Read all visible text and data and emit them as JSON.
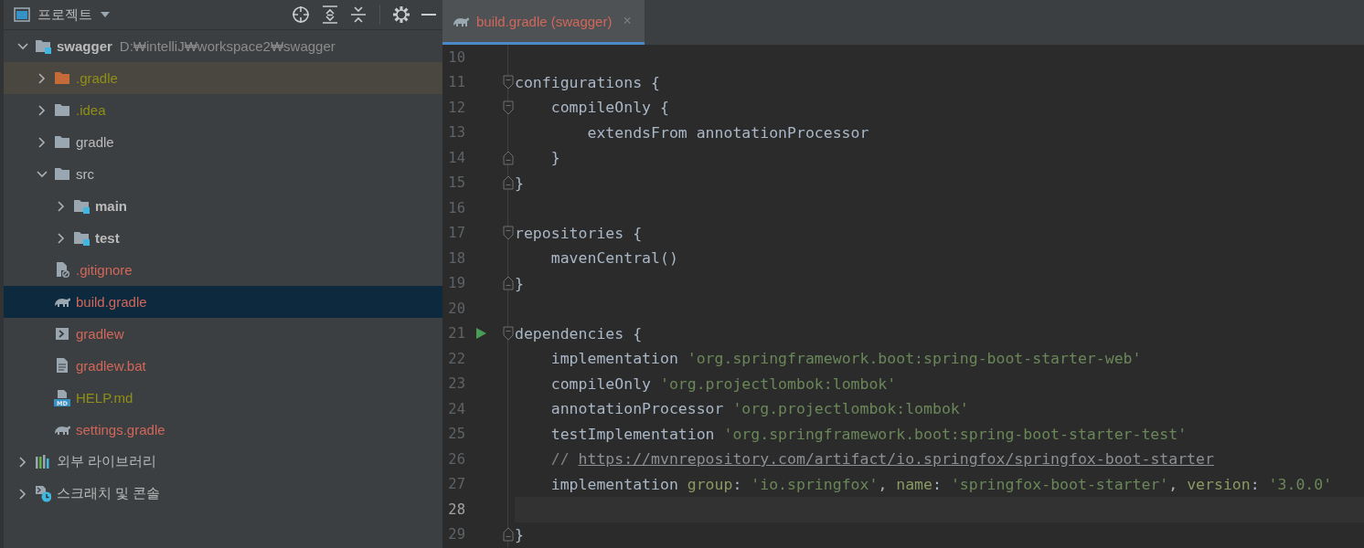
{
  "project_panel": {
    "title": "프로젝트",
    "tree": [
      {
        "label": "swagger",
        "kind": "module",
        "path": "D:₩intelliJ₩workspace2₩swagger",
        "selected": false,
        "expanded": true,
        "children": [
          {
            "label": ".gradle",
            "kind": "excluded-folder",
            "color": "#8f8f16",
            "selected": false,
            "expanded": false
          },
          {
            "label": ".idea",
            "kind": "folder",
            "color": "#8f8f16",
            "selected": false,
            "expanded": false
          },
          {
            "label": "gradle",
            "kind": "folder",
            "selected": false,
            "expanded": false
          },
          {
            "label": "src",
            "kind": "folder",
            "selected": false,
            "expanded": true,
            "children": [
              {
                "label": "main",
                "kind": "source-root",
                "selected": false,
                "expanded": false
              },
              {
                "label": "test",
                "kind": "source-root",
                "selected": false,
                "expanded": false
              }
            ]
          },
          {
            "label": ".gitignore",
            "kind": "ignore-file",
            "color": "#d1675a",
            "selected": false
          },
          {
            "label": "build.gradle",
            "kind": "gradle-file",
            "color": "#d1675a",
            "selected": true
          },
          {
            "label": "gradlew",
            "kind": "shell-file",
            "color": "#d1675a",
            "selected": false
          },
          {
            "label": "gradlew.bat",
            "kind": "text-file",
            "color": "#d1675a",
            "selected": false
          },
          {
            "label": "HELP.md",
            "kind": "markdown-file",
            "badge": "MD",
            "color": "#8f8f16",
            "selected": false
          },
          {
            "label": "settings.gradle",
            "kind": "gradle-file",
            "color": "#d1675a",
            "selected": false
          }
        ]
      },
      {
        "label": "외부 라이브러리",
        "kind": "libraries",
        "selected": false,
        "expanded": false
      },
      {
        "label": "스크래치 및 콘솔",
        "kind": "scratches",
        "selected": false,
        "expanded": false
      }
    ]
  },
  "editor": {
    "tabs": [
      {
        "label": "build.gradle (swagger)",
        "close": "×",
        "color": "#d1675a",
        "selected": true
      }
    ],
    "lines": [
      {
        "number": "10",
        "kind": "plain",
        "current": false,
        "run": false
      },
      {
        "number": "11",
        "kind": "fold-start",
        "current": false,
        "run": false,
        "tokens": [
          {
            "kind": "plain",
            "text": "configurations {"
          }
        ]
      },
      {
        "number": "12",
        "kind": "fold-start",
        "current": false,
        "run": false,
        "tokens": [
          {
            "kind": "plain",
            "text": "    compileOnly {"
          }
        ]
      },
      {
        "number": "13",
        "kind": "plain",
        "current": false,
        "run": false,
        "tokens": [
          {
            "kind": "plain",
            "text": "        extendsFrom annotationProcessor"
          }
        ]
      },
      {
        "number": "14",
        "kind": "fold-end",
        "current": false,
        "run": false,
        "tokens": [
          {
            "kind": "plain",
            "text": "    }"
          }
        ]
      },
      {
        "number": "15",
        "kind": "fold-end",
        "current": false,
        "run": false,
        "tokens": [
          {
            "kind": "plain",
            "text": "}"
          }
        ]
      },
      {
        "number": "16",
        "kind": "plain",
        "current": false,
        "run": false
      },
      {
        "number": "17",
        "kind": "fold-start",
        "current": false,
        "run": false,
        "tokens": [
          {
            "kind": "plain",
            "text": "repositories {"
          }
        ]
      },
      {
        "number": "18",
        "kind": "plain",
        "current": false,
        "run": false,
        "tokens": [
          {
            "kind": "plain",
            "text": "    mavenCentral()"
          }
        ]
      },
      {
        "number": "19",
        "kind": "fold-end",
        "current": false,
        "run": false,
        "tokens": [
          {
            "kind": "plain",
            "text": "}"
          }
        ]
      },
      {
        "number": "20",
        "kind": "plain",
        "current": false,
        "run": false
      },
      {
        "number": "21",
        "kind": "fold-start",
        "current": false,
        "run": true,
        "tokens": [
          {
            "kind": "plain",
            "text": "dependencies {"
          }
        ]
      },
      {
        "number": "22",
        "kind": "plain",
        "current": false,
        "run": false,
        "tokens": [
          {
            "kind": "plain",
            "text": "    implementation "
          },
          {
            "kind": "string",
            "text": "'org.springframework.boot:spring-boot-starter-web'"
          }
        ]
      },
      {
        "number": "23",
        "kind": "plain",
        "current": false,
        "run": false,
        "tokens": [
          {
            "kind": "plain",
            "text": "    compileOnly "
          },
          {
            "kind": "string",
            "text": "'org.projectlombok:lombok'"
          }
        ]
      },
      {
        "number": "24",
        "kind": "plain",
        "current": false,
        "run": false,
        "tokens": [
          {
            "kind": "plain",
            "text": "    annotationProcessor "
          },
          {
            "kind": "string",
            "text": "'org.projectlombok:lombok'"
          }
        ]
      },
      {
        "number": "25",
        "kind": "plain",
        "current": false,
        "run": false,
        "tokens": [
          {
            "kind": "plain",
            "text": "    testImplementation "
          },
          {
            "kind": "string",
            "text": "'org.springframework.boot:spring-boot-starter-test'"
          }
        ]
      },
      {
        "number": "26",
        "kind": "plain",
        "current": false,
        "run": false,
        "tokens": [
          {
            "kind": "comment",
            "text": "    // "
          },
          {
            "kind": "link",
            "text": "https://mvnrepository.com/artifact/io.springfox/springfox-boot-starter"
          }
        ]
      },
      {
        "number": "27",
        "kind": "plain",
        "current": false,
        "run": false,
        "tokens": [
          {
            "kind": "plain",
            "text": "    implementation "
          },
          {
            "kind": "named",
            "text": "group"
          },
          {
            "kind": "plain",
            "text": ": "
          },
          {
            "kind": "string",
            "text": "'io.springfox'"
          },
          {
            "kind": "plain",
            "text": ", "
          },
          {
            "kind": "named",
            "text": "name"
          },
          {
            "kind": "plain",
            "text": ": "
          },
          {
            "kind": "string",
            "text": "'springfox-boot-starter'"
          },
          {
            "kind": "plain",
            "text": ", "
          },
          {
            "kind": "named",
            "text": "version"
          },
          {
            "kind": "plain",
            "text": ": "
          },
          {
            "kind": "string",
            "text": "'3.0.0'"
          }
        ]
      },
      {
        "number": "28",
        "kind": "plain",
        "current": true,
        "run": false
      },
      {
        "number": "29",
        "kind": "fold-end",
        "current": false,
        "run": false,
        "tokens": [
          {
            "kind": "plain",
            "text": "}"
          }
        ]
      }
    ]
  }
}
